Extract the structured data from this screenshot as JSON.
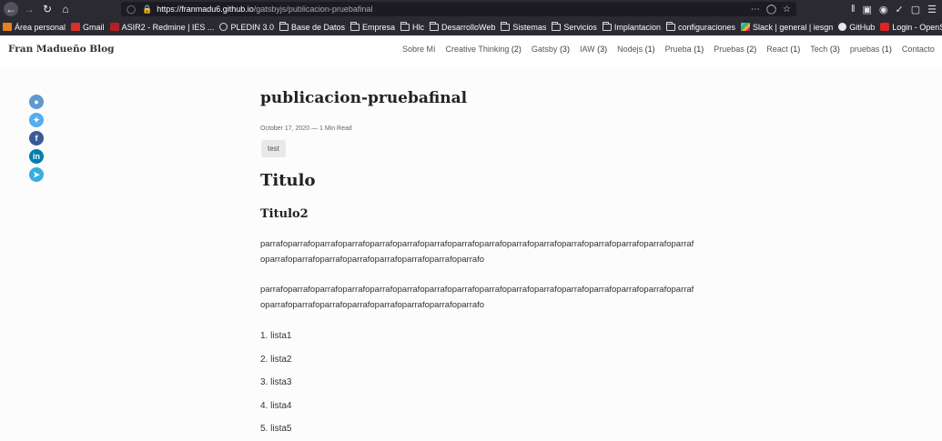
{
  "browser": {
    "url_host": "https://franmadu6.github.io",
    "url_path": "/gatsbyjs/publicacion-pruebafinal",
    "bookmarks": [
      {
        "label": "Área personal",
        "icon": "moodle-icon"
      },
      {
        "label": "Gmail",
        "icon": "gmail-icon"
      },
      {
        "label": "ASIR2 - Redmine | IES ...",
        "icon": "redmine-icon"
      },
      {
        "label": "PLEDIN 3.0",
        "icon": "globe-icon"
      },
      {
        "label": "Base de Datos",
        "icon": "folder-icon"
      },
      {
        "label": "Empresa",
        "icon": "folder-icon"
      },
      {
        "label": "Hlc",
        "icon": "folder-icon"
      },
      {
        "label": "DesarrolloWeb",
        "icon": "folder-icon"
      },
      {
        "label": "Sistemas",
        "icon": "folder-icon"
      },
      {
        "label": "Servicios",
        "icon": "folder-icon"
      },
      {
        "label": "Implantacion",
        "icon": "folder-icon"
      },
      {
        "label": "configuraciones",
        "icon": "folder-icon"
      },
      {
        "label": "Slack | general | iesgn",
        "icon": "slack-icon"
      },
      {
        "label": "GitHub",
        "icon": "github-icon"
      },
      {
        "label": "Login - OpenStack Das...",
        "icon": "openstack-icon"
      }
    ]
  },
  "site": {
    "brand": "Fran Madueño Blog",
    "nav": [
      {
        "label": "Sobre Mí",
        "count": ""
      },
      {
        "label": "Creative Thinking",
        "count": "(2)"
      },
      {
        "label": "Gatsby",
        "count": "(3)"
      },
      {
        "label": "IAW",
        "count": "(3)"
      },
      {
        "label": "Nodejs",
        "count": "(1)"
      },
      {
        "label": "Prueba",
        "count": "(1)"
      },
      {
        "label": "Pruebas",
        "count": "(2)"
      },
      {
        "label": "React",
        "count": "(1)"
      },
      {
        "label": "Tech",
        "count": "(3)"
      },
      {
        "label": "pruebas",
        "count": "(1)"
      },
      {
        "label": "Contacto",
        "count": ""
      }
    ]
  },
  "share": {
    "reddit": "reddit-icon",
    "twitter": "twitter-icon",
    "facebook": "facebook-icon",
    "linkedin": "linkedin-icon",
    "telegram": "telegram-icon"
  },
  "post": {
    "title": "publicacion-pruebafinal",
    "meta": "October 17, 2020 — 1 Min Read",
    "tag": "test",
    "h1": "Titulo",
    "h2": "Titulo2",
    "paragraph1": "parrafoparrafoparrafoparrafoparrafoparrafoparrafoparrafoparrafoparrafoparrafoparrafoparrafoparrafoparrafoparrafoparrafoparrafoparrafoparrafoparrafoparrafoparrafoparrafo",
    "paragraph2": "parrafoparrafoparrafoparrafoparrafoparrafoparrafoparrafoparrafoparrafoparrafoparrafoparrafoparrafoparrafoparrafoparrafoparrafoparrafoparrafoparrafoparrafoparrafoparrafo",
    "list": [
      "lista1",
      "lista2",
      "lista3",
      "lista4",
      "lista5"
    ]
  }
}
